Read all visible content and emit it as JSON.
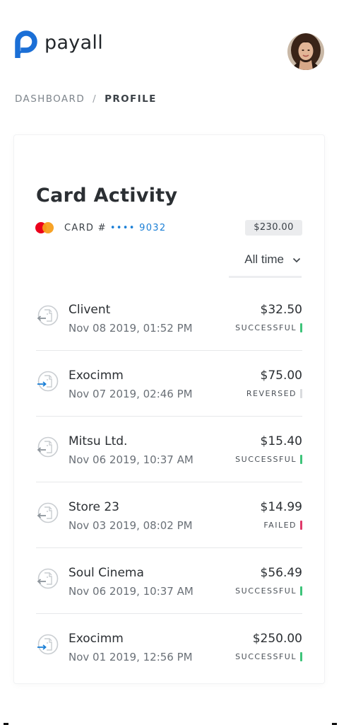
{
  "app": {
    "brand_name": "payall",
    "brand_color": "#1b6fd6"
  },
  "header": {
    "avatar_icon": "user-avatar-photo"
  },
  "breadcrumb": {
    "root": "DASHBOARD",
    "separator": "/",
    "current": "PROFILE"
  },
  "activity": {
    "title": "Card Activity",
    "card_label": "CARD #",
    "card_number_masked": "•••• 9032",
    "card_brand_icon": "mastercard-icon",
    "balance": "$230.00",
    "filter_value": "All time",
    "filter_icon": "chevron-down-icon",
    "transactions": [
      {
        "name": "Clivent",
        "date": "Nov 08 2019, 01:52 PM",
        "amount": "$32.50",
        "status": "SUCCESSFUL",
        "direction": "incoming",
        "status_color": "#3ec47a"
      },
      {
        "name": "Exocimm",
        "date": "Nov 07 2019, 02:46 PM",
        "amount": "$75.00",
        "status": "REVERSED",
        "direction": "outgoing",
        "status_color": "#d9dbde"
      },
      {
        "name": "Mitsu Ltd.",
        "date": "Nov 06 2019, 10:37 AM",
        "amount": "$15.40",
        "status": "SUCCESSFUL",
        "direction": "incoming",
        "status_color": "#3ec47a"
      },
      {
        "name": "Store 23",
        "date": "Nov 03 2019, 08:02 PM",
        "amount": "$14.99",
        "status": "FAILED",
        "direction": "incoming",
        "status_color": "#e03a6a"
      },
      {
        "name": "Soul Cinema",
        "date": "Nov 06 2019, 10:37 AM",
        "amount": "$56.49",
        "status": "SUCCESSFUL",
        "direction": "incoming",
        "status_color": "#3ec47a"
      },
      {
        "name": "Exocimm",
        "date": "Nov 01 2019, 12:56 PM",
        "amount": "$250.00",
        "status": "SUCCESSFUL",
        "direction": "outgoing",
        "status_color": "#3ec47a"
      }
    ]
  }
}
